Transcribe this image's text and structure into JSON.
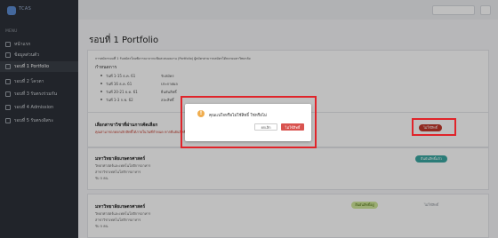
{
  "app": {
    "logo_text": "TCAS"
  },
  "sidebar": {
    "caption": "MENU",
    "items": [
      {
        "label": "หน้าแรก"
      },
      {
        "label": "ข้อมูลส่วนตัว"
      },
      {
        "label": "รอบที่ 1 Portfolio"
      },
      {
        "label": "รอบที่ 2 โควตา"
      },
      {
        "label": "รอบที่ 3 รับตรงร่วมกัน"
      },
      {
        "label": "รอบที่ 4 Admission"
      },
      {
        "label": "รอบที่ 5 รับตรงอิสระ"
      }
    ]
  },
  "page": {
    "title": "รอบที่ 1 Portfolio",
    "intro": "การสมัครรอบที่ 1 รับสมัครโดยพิจารณาจากแฟ้มสะสมผลงาน (Portfolio) ผู้สมัครสามารถสมัครได้หลายมหาวิทยาลัย",
    "schedule_title": "กำหนดการ",
    "schedule": [
      {
        "date": "วันที่ 1-15 ธ.ค. 61",
        "label": "รับสมัคร"
      },
      {
        "date": "วันที่ 16 ธ.ค. 61",
        "label": "ประกาศผล"
      },
      {
        "date": "วันที่ 20-21 ธ.ค. 61",
        "label": "ยืนยันสิทธิ์"
      },
      {
        "date": "วันที่ 1-3 ก.พ. 62",
        "label": "สละสิทธิ์"
      }
    ]
  },
  "schools": [
    {
      "name": "เลือกสาขาวิชาที่ผ่านการคัดเลือก",
      "warning": "คุณสามารถกดยกเลิกสิทธิ์ได้ภายในวันที่กำหนด หากยืนยันสิทธิ์แล้วจะไม่สามารถเปลี่ยนแปลงได้ภายหลัง ได้เพียง 1 ครั้ง",
      "action": "ไม่ใช้สิทธิ์"
    },
    {
      "name": "มหาวิทยาลัยเกษตรศาสตร์",
      "lines": [
        "วิทยาศาสตร์และเทคโนโลยีการอาหาร",
        "สาขาวิชาเทคโนโลยีการอาหาร",
        "รับ 5 คน"
      ],
      "action": "ยืนยันสิทธิ์แล้ว"
    },
    {
      "name": "มหาวิทยาลัยเกษตรศาสตร์",
      "lines": [
        "วิทยาศาสตร์และเทคโนโลยีการอาหาร",
        "สาขาวิชาเทคโนโลยีการอาหาร",
        "รับ 5 คน"
      ],
      "status": "ยืนยันสิทธิ์อยู่",
      "action": "ไม่ใช้สิทธิ์"
    }
  ],
  "modal": {
    "icon": "!",
    "message": "คุณแน่ใจหรือไม่ใช้สิทธิ์ ใช่หรือไม่",
    "cancel_label": "ยกเลิก",
    "confirm_label": "ไม่ใช้สิทธิ์"
  },
  "colors": {
    "sidebar_bg": "#2d3138",
    "highlight": "#e0242a",
    "danger": "#d9534f",
    "warning_icon": "#f0ad4e",
    "teal": "#3aa6a0"
  }
}
